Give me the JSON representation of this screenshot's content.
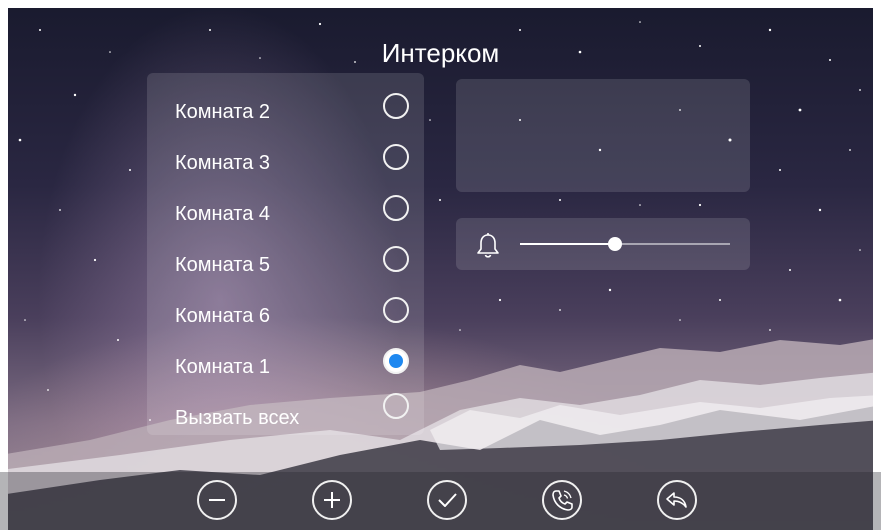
{
  "screen": {
    "title": "Интерком"
  },
  "rooms": [
    {
      "label": "Комната 2",
      "selected": false
    },
    {
      "label": "Комната 3",
      "selected": false
    },
    {
      "label": "Комната 4",
      "selected": false
    },
    {
      "label": "Комната 5",
      "selected": false
    },
    {
      "label": "Комната 6",
      "selected": false
    },
    {
      "label": "Комната 1",
      "selected": true
    },
    {
      "label": "Вызвать всех",
      "selected": false
    }
  ],
  "volume": {
    "icon": "bell-icon",
    "level": 0.45
  },
  "toolbar": {
    "buttons": [
      {
        "name": "minus-button",
        "icon": "minus-icon"
      },
      {
        "name": "plus-button",
        "icon": "plus-icon"
      },
      {
        "name": "confirm-button",
        "icon": "check-icon"
      },
      {
        "name": "call-button",
        "icon": "phone-icon"
      },
      {
        "name": "back-button",
        "icon": "back-icon"
      }
    ]
  },
  "colors": {
    "accent": "#1e88f0",
    "text": "#ffffff"
  }
}
